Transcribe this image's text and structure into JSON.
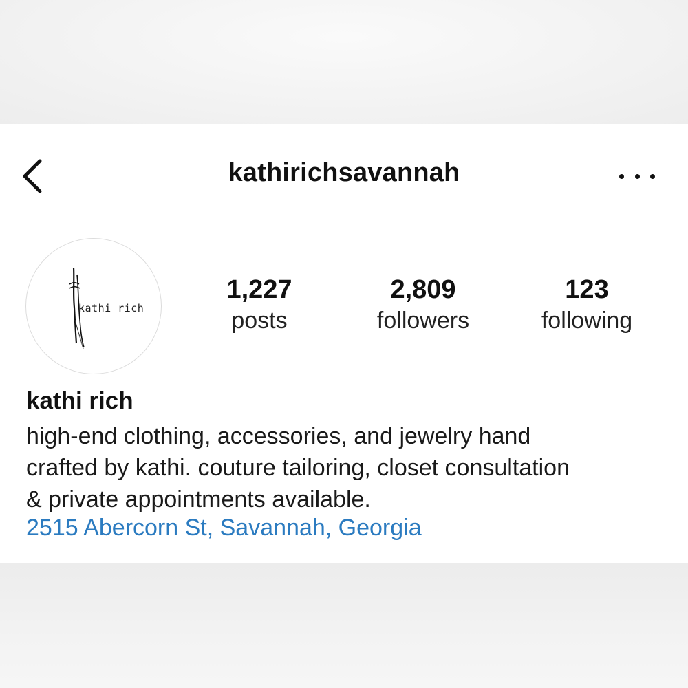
{
  "header": {
    "username": "kathirichsavannah",
    "back_icon": "chevron-left-icon",
    "more_icon": "more-horizontal-icon"
  },
  "profile": {
    "avatar_text": "kathi rich",
    "stats": {
      "posts": {
        "count": "1,227",
        "label": "posts"
      },
      "followers": {
        "count": "2,809",
        "label": "followers"
      },
      "following": {
        "count": "123",
        "label": "following"
      }
    },
    "display_name": "kathi rich",
    "bio_lines": [
      "high-end clothing, accessories, and jewelry hand",
      "crafted by kathi. couture tailoring, closet consultation",
      "& private appointments available."
    ],
    "address": "2515 Abercorn St, Savannah, Georgia"
  },
  "colors": {
    "link": "#2b7bc0",
    "text": "#111111",
    "background": "#ffffff"
  }
}
